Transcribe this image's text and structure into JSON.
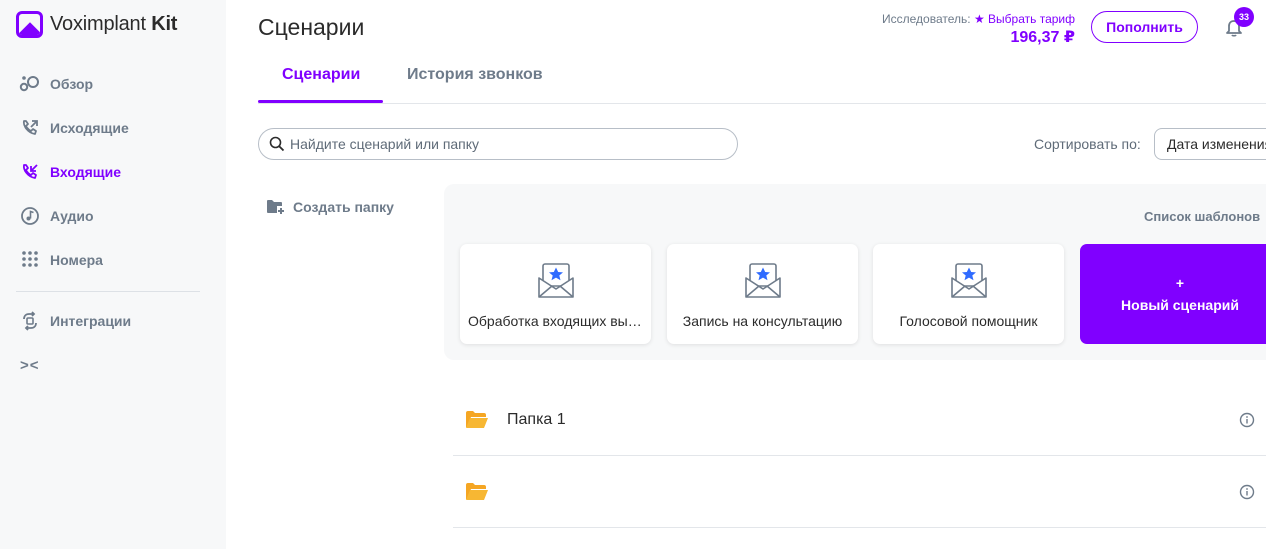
{
  "app": {
    "logo_text": "Voximplant",
    "logo_bold": "Kit"
  },
  "sidebar": {
    "items": [
      {
        "label": "Обзор"
      },
      {
        "label": "Исходящие"
      },
      {
        "label": "Входящие",
        "active": true
      },
      {
        "label": "Аудио"
      },
      {
        "label": "Номера"
      },
      {
        "label": "Интеграции"
      }
    ],
    "collapse_label": "><"
  },
  "header": {
    "title": "Сценарии",
    "plan_label": "Исследователь:",
    "plan_tariff": "★ Выбрать тариф",
    "balance": "196,37 ₽",
    "topup_label": "Пополнить",
    "notifications_count": "33"
  },
  "tabs": [
    {
      "label": "Сценарии",
      "active": true
    },
    {
      "label": "История звонков"
    }
  ],
  "search": {
    "placeholder": "Найдите сценарий или папку",
    "value": ""
  },
  "sort": {
    "label": "Сортировать по:",
    "value": "Дата изменения"
  },
  "create_folder_label": "Создать папку",
  "templates": {
    "title": "Список шаблонов",
    "cards": [
      {
        "label": "Обработка входящих вызовов"
      },
      {
        "label": "Запись на консультацию"
      },
      {
        "label": "Голосовой помощник"
      }
    ],
    "new_plus": "+",
    "new_label": "Новый сценарий"
  },
  "folders": [
    {
      "name": "Папка 1"
    },
    {
      "name": ""
    }
  ],
  "colors": {
    "accent": "#8000ff",
    "folder": "#f5a623",
    "muted": "#6e7b8a"
  }
}
